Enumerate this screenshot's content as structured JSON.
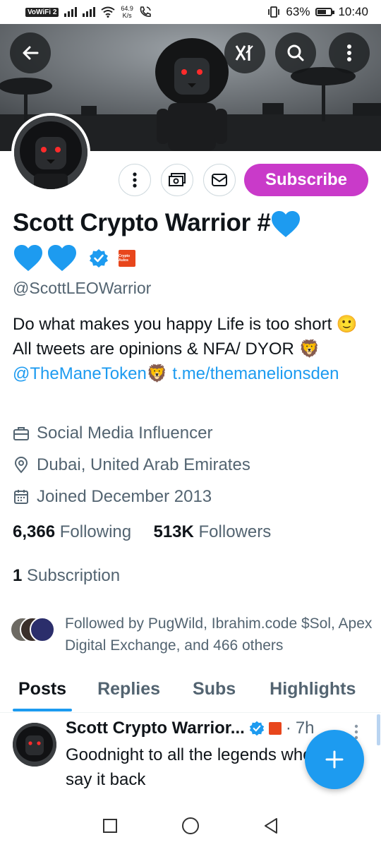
{
  "status_bar": {
    "wifi_badge": "VoWiFi 2",
    "net_speed_value": "64.9",
    "net_speed_unit": "K/s",
    "battery_percent": "63%",
    "battery_level": 0.63,
    "time": "10:40"
  },
  "header": {
    "back_icon": "arrow-left-icon",
    "grok_icon": "grok-icon",
    "search_icon": "search-icon",
    "more_icon": "more-vertical-icon"
  },
  "profile": {
    "name": "Scott Crypto Warrior #",
    "handle": "@ScottLEOWarrior",
    "affiliate_badge_text": "Crypto Aulos",
    "bio": {
      "line_a": "Do what makes you happy     Life is too short ",
      "emoji_smile": "🙂",
      "line_b": "  All tweets are opinions & NFA/ DYOR     ",
      "lion_1": "🦁",
      "mention": "@TheManeToken",
      "lion_2": "🦁",
      "link_a": " t.me/",
      "link_b": "themanelionsden"
    },
    "category": "Social Media Influencer",
    "location": "Dubai, United Arab Emirates",
    "joined": "Joined December 2013",
    "following_count": "6,366",
    "following_label": "Following",
    "followers_count": "513K",
    "followers_label": "Followers",
    "subscription_count": "1",
    "subscription_label": "Subscription",
    "followed_by": "Followed by PugWild, Ibrahim.code $Sol, Apex Digital Exchange, and 466 others"
  },
  "actions": {
    "subscribe_label": "Subscribe"
  },
  "tabs": [
    {
      "label": "Posts",
      "active": true
    },
    {
      "label": "Replies",
      "active": false
    },
    {
      "label": "Subs",
      "active": false
    },
    {
      "label": "Highlights",
      "active": false
    }
  ],
  "tweet": {
    "author": "Scott Crypto Warrior...",
    "time_sep": "·",
    "time": "7h",
    "text": "Goodnight to all the legends who say it back"
  },
  "colors": {
    "accent": "#1d9bf0",
    "subscribe": "#c93ac9",
    "secondary_text": "#536471",
    "heart": "#1d9bf0",
    "affiliate": "#e8461c"
  }
}
